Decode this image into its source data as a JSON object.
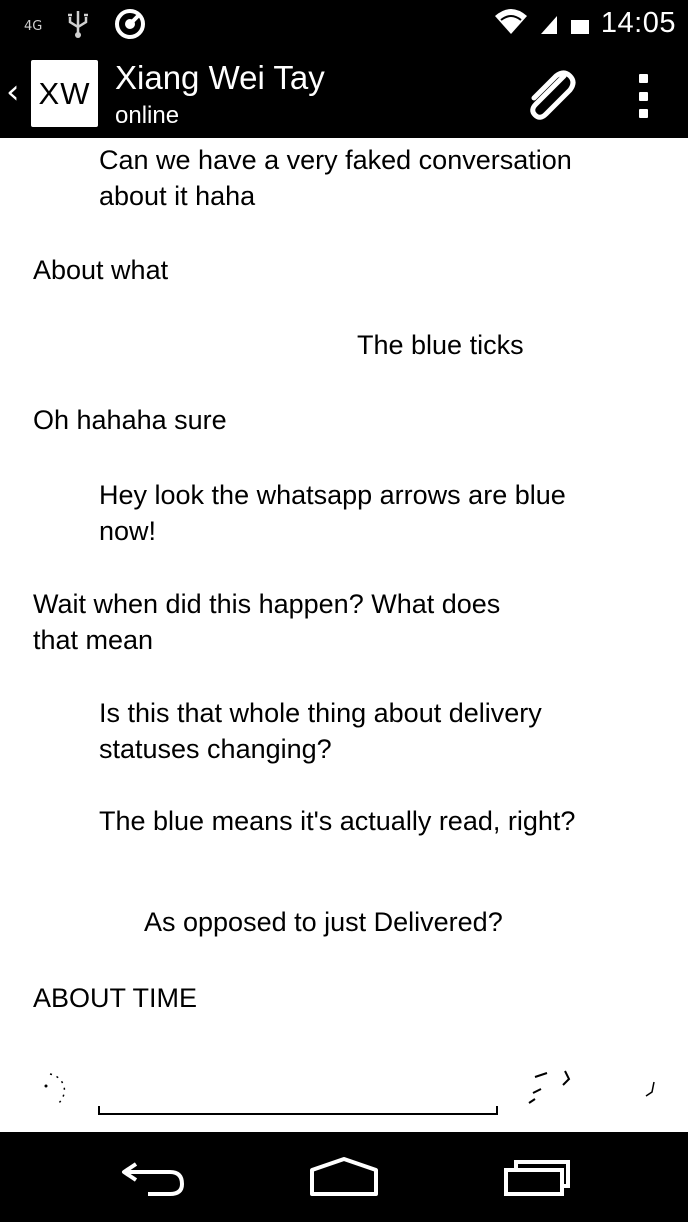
{
  "status_bar": {
    "network_label": "4G",
    "time": "14:05",
    "icons": [
      "4g-icon",
      "usb-debug-icon",
      "sync-icon",
      "wifi-icon",
      "signal-icon",
      "battery-icon"
    ]
  },
  "action_bar": {
    "avatar_initials": "XW",
    "contact_name": "Xiang Wei Tay",
    "contact_status": "online",
    "icons": [
      "back-chevron-icon",
      "paperclip-icon",
      "overflow-menu-icon"
    ]
  },
  "messages": [
    {
      "direction": "outgoing",
      "lines": [
        "Can we have a very faked conversation",
        "about it haha"
      ]
    },
    {
      "direction": "incoming",
      "lines": [
        "About what"
      ]
    },
    {
      "direction": "outgoing",
      "lines": [
        "The blue ticks"
      ]
    },
    {
      "direction": "incoming",
      "lines": [
        "Oh hahaha sure"
      ]
    },
    {
      "direction": "outgoing",
      "lines": [
        "Hey look the whatsapp arrows are blue",
        "now!"
      ]
    },
    {
      "direction": "incoming",
      "lines": [
        "Wait when did this happen? What does",
        "that mean"
      ]
    },
    {
      "direction": "outgoing",
      "lines": [
        "Is this that whole thing about delivery",
        "statuses changing?"
      ]
    },
    {
      "direction": "outgoing",
      "lines": [
        "The blue means it's actually read, right?"
      ]
    },
    {
      "direction": "outgoing",
      "lines": [
        "As opposed to just Delivered?"
      ]
    },
    {
      "direction": "incoming",
      "lines": [
        "ABOUT TIME"
      ]
    }
  ],
  "input": {
    "value": "",
    "icons": [
      "emoji-icon",
      "mic-icon",
      "send-icon"
    ]
  },
  "nav_bar": {
    "icons": [
      "back-nav-icon",
      "home-nav-icon",
      "recents-nav-icon"
    ]
  },
  "colors": {
    "bars": "#000000",
    "chat_background": "#ffffff",
    "text_on_bars": "#ffffff",
    "message_text": "#000000"
  }
}
